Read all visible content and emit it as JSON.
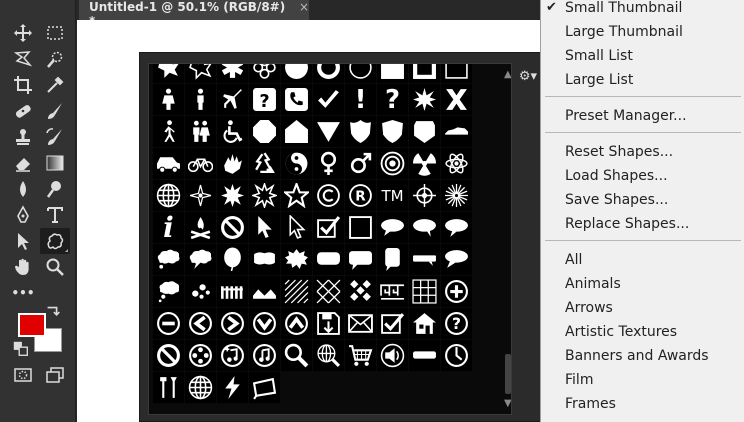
{
  "document": {
    "tab_title": "Untitled-1 @ 50.1% (RGB/8#) *",
    "tab_close": "×"
  },
  "colors": {
    "foreground": "#e00000",
    "background": "#ffffff",
    "menu_bg": "#f0f0f0",
    "panel_bg": "#2b2b2b"
  },
  "toolbar": {
    "tools": [
      "move-icon",
      "marquee-icon",
      "lasso-icon",
      "quick-select-icon",
      "crop-icon",
      "eyedropper-icon",
      "healing-brush-icon",
      "brush-icon",
      "clone-stamp-icon",
      "history-brush-icon",
      "eraser-icon",
      "gradient-icon",
      "blur-icon",
      "dodge-icon",
      "pen-icon",
      "type-icon",
      "path-select-icon",
      "custom-shape-icon",
      "hand-icon",
      "zoom-icon",
      "more-tools-icon"
    ],
    "more_label": "•••"
  },
  "picker": {
    "gear": "⚙▾",
    "scroll_up": "▲",
    "scroll_down": "▼",
    "text_shapes": {
      "tm": "TM",
      "copyright": "©",
      "registered": "R",
      "info": "i",
      "question": "?",
      "exclaim": "!"
    }
  },
  "menu": {
    "checked_index": 0,
    "check_glyph": "✔",
    "groups": [
      [
        "Small Thumbnail",
        "Large Thumbnail",
        "Small List",
        "Large List"
      ],
      [
        "Preset Manager..."
      ],
      [
        "Reset Shapes...",
        "Load Shapes...",
        "Save Shapes...",
        "Replace Shapes..."
      ],
      [
        "All",
        "Animals",
        "Arrows",
        "Artistic Textures",
        "Banners and Awards",
        "Film",
        "Frames"
      ]
    ]
  }
}
